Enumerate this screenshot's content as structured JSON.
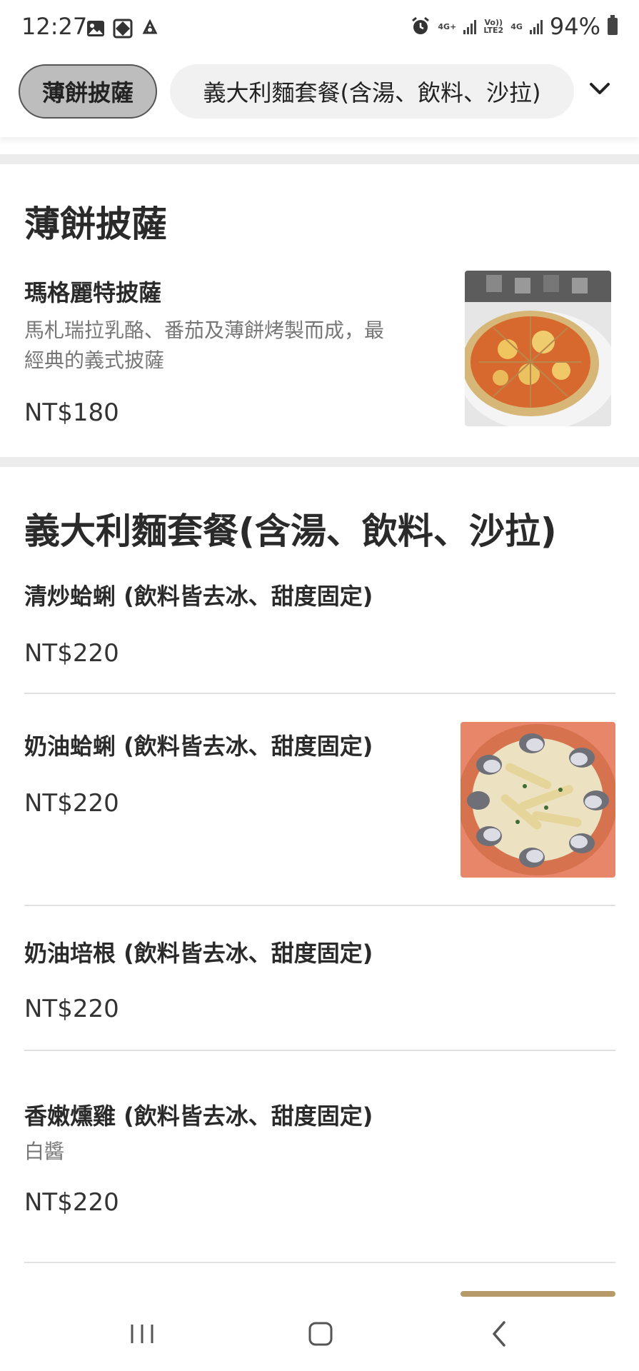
{
  "status_bar": {
    "time": "12:27",
    "battery": "94%",
    "net1": "4G+",
    "volte_top": "Vo))",
    "volte_bottom": "LTE2",
    "net2": "4G"
  },
  "categories": {
    "active": "薄餅披薩",
    "second": "義大利麵套餐(含湯、飲料、沙拉)"
  },
  "sections": [
    {
      "title": "薄餅披薩",
      "items": [
        {
          "name": "瑪格麗特披薩",
          "desc_line1": "馬札瑞拉乳酪、番茄及薄餅烤製而成，最",
          "desc_line2": "經典的義式披薩",
          "price": "NT$180"
        }
      ]
    },
    {
      "title": "義大利麵套餐(含湯、飲料、沙拉)",
      "items": [
        {
          "name": "清炒蛤蜊 (飲料皆去冰、甜度固定)",
          "price": "NT$220"
        },
        {
          "name": "奶油蛤蜊 (飲料皆去冰、甜度固定)",
          "price": "NT$220"
        },
        {
          "name": "奶油培根 (飲料皆去冰、甜度固定)",
          "price": "NT$220"
        },
        {
          "name": "香嫩燻雞 (飲料皆去冰、甜度固定)",
          "desc": "白醬",
          "price": "NT$220"
        }
      ]
    }
  ],
  "colors": {
    "chip_active_bg": "#bdbdbd",
    "chip_bg": "#f1f1f1",
    "band": "#ececec"
  }
}
